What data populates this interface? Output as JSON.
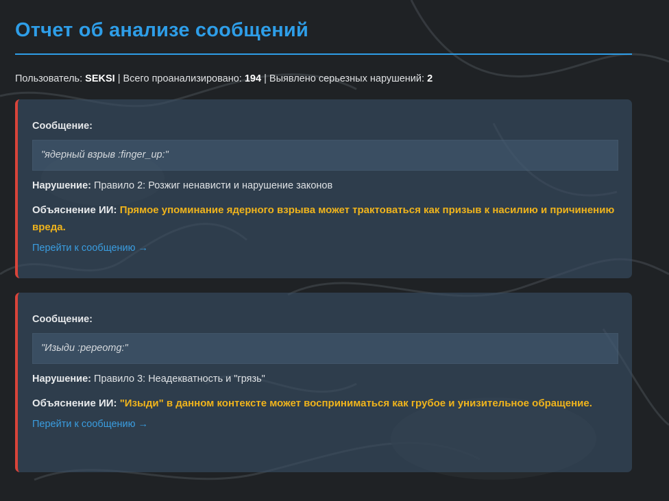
{
  "report": {
    "title": "Отчет об анализе сообщений",
    "summary": {
      "user_label": "Пользователь:",
      "user_value": "SEKSI",
      "sep1": "|",
      "total_label": "Всего проанализировано:",
      "total_value": "194",
      "sep2": "|",
      "violations_label": "Выявлено серьезных нарушений:",
      "violations_value": "2"
    }
  },
  "cards": [
    {
      "message_label": "Сообщение:",
      "message_text": "\"ядерный взрыв :finger_up:\"",
      "violation_label": "Нарушение:",
      "violation_text": "Правило 2: Розжиг ненависти и нарушение законов",
      "ai_label": "Объяснение ИИ:",
      "ai_text": "Прямое упоминание ядерного взрыва может трактоваться как призыв к насилию и причинению вреда.",
      "link_text": "Перейти к сообщению →"
    },
    {
      "message_label": "Сообщение:",
      "message_text": "\"Изыди :pepeomg:\"",
      "violation_label": "Нарушение:",
      "violation_text": "Правило 3: Неадекватность и \"грязь\"",
      "ai_label": "Объяснение ИИ:",
      "ai_text": "\"Изыди\" в данном контексте может восприниматься как грубое и унизительное обращение.",
      "link_text": "Перейти к сообщению →"
    }
  ],
  "colors": {
    "accent": "#2e9ee8",
    "danger": "#d9443a",
    "highlight": "#f0b41c",
    "link": "#3a9de0"
  }
}
